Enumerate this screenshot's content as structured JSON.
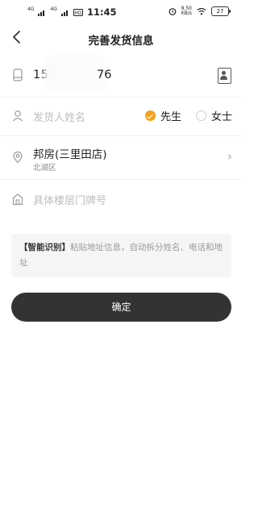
{
  "status_bar": {
    "network_1": "4G",
    "network_2": "4G",
    "time": "11:45",
    "speed_value": "9.50",
    "speed_unit": "KB/s",
    "battery": "27"
  },
  "header": {
    "title": "完善发货信息",
    "back_icon": "chevron-left-icon"
  },
  "form": {
    "phone_prefix": "158",
    "phone_suffix": "76",
    "name_placeholder": "发货人姓名",
    "gender_options": [
      {
        "label": "先生",
        "selected": true
      },
      {
        "label": "女士",
        "selected": false
      }
    ],
    "address": {
      "name": "邦房(三里田店)",
      "district": "北湖区"
    },
    "detail_placeholder": "具体楼层门牌号"
  },
  "smart_paste": {
    "tag": "【智能识别】",
    "placeholder": "粘贴地址信息，自动拆分姓名、电话和地址"
  },
  "confirm_button": {
    "label": "确定"
  },
  "colors": {
    "accent": "#f5a11a",
    "button_bg": "#333333"
  }
}
